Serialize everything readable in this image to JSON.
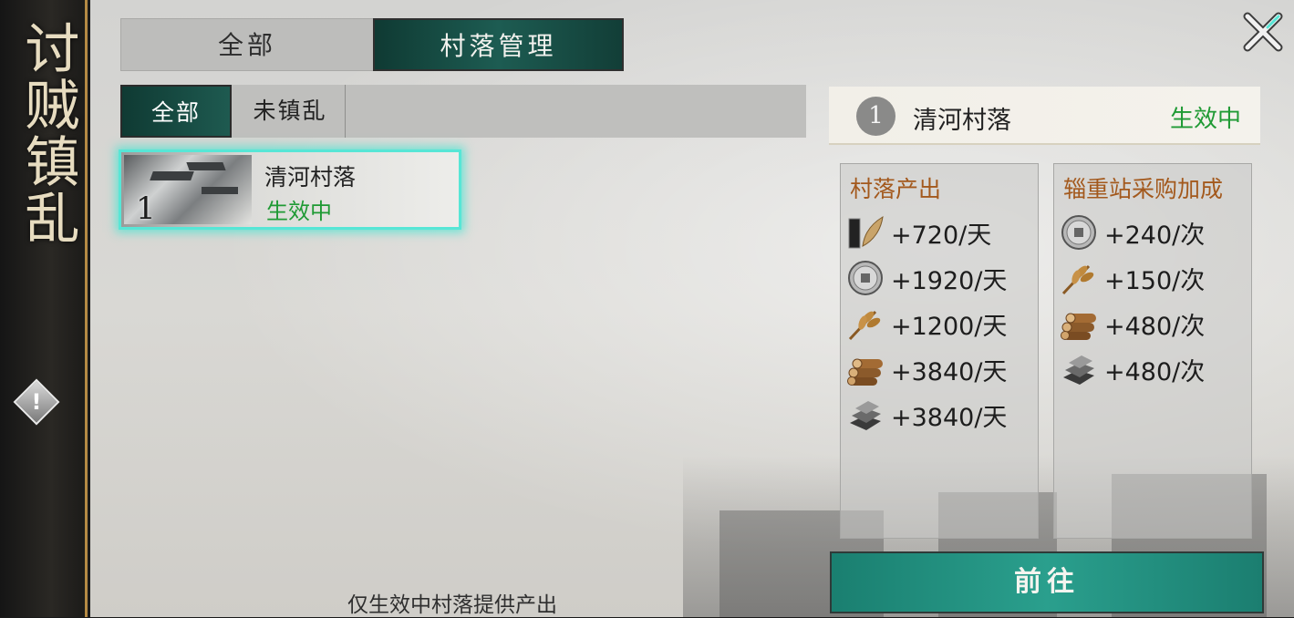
{
  "side": {
    "title": "讨贼镇乱",
    "info_label": "!"
  },
  "tabs": {
    "all": "全部",
    "village_management": "村落管理"
  },
  "subtabs": {
    "all": "全部",
    "unsettled": "未镇乱"
  },
  "village_list": [
    {
      "index": "1",
      "name": "清河村落",
      "status": "生效中"
    }
  ],
  "footnote": "仅生效中村落提供产出",
  "details": {
    "index": "1",
    "name": "清河村落",
    "status": "生效中",
    "production": {
      "title": "村落产出",
      "items": [
        {
          "icon": "population-scroll-icon",
          "value": "+720/天"
        },
        {
          "icon": "coin-icon",
          "value": "+1920/天"
        },
        {
          "icon": "grain-icon",
          "value": "+1200/天"
        },
        {
          "icon": "wood-icon",
          "value": "+3840/天"
        },
        {
          "icon": "iron-icon",
          "value": "+3840/天"
        }
      ]
    },
    "bonus": {
      "title": "辎重站采购加成",
      "items": [
        {
          "icon": "coin-icon",
          "value": "+240/次"
        },
        {
          "icon": "grain-icon",
          "value": "+150/次"
        },
        {
          "icon": "wood-icon",
          "value": "+480/次"
        },
        {
          "icon": "iron-icon",
          "value": "+480/次"
        }
      ]
    }
  },
  "go_button": "前往",
  "colors": {
    "accent": "#1e8a7a",
    "status_active": "#1f9a34",
    "title_orange": "#a3591d",
    "highlight": "#57e6d6"
  }
}
